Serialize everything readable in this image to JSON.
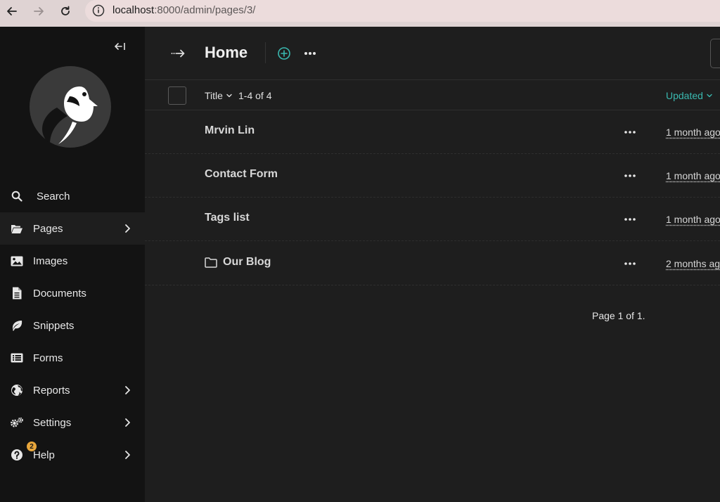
{
  "browser": {
    "url_host": "localhost",
    "url_path": ":8000/admin/pages/3/"
  },
  "sidebar": {
    "items": [
      {
        "label": "Search",
        "icon": "search-icon"
      },
      {
        "label": "Pages",
        "icon": "folder-open-icon"
      },
      {
        "label": "Images",
        "icon": "image-icon"
      },
      {
        "label": "Documents",
        "icon": "document-icon"
      },
      {
        "label": "Snippets",
        "icon": "leaf-icon"
      },
      {
        "label": "Forms",
        "icon": "list-icon"
      },
      {
        "label": "Reports",
        "icon": "globe-icon"
      },
      {
        "label": "Settings",
        "icon": "cogs-icon"
      },
      {
        "label": "Help",
        "icon": "help-icon"
      }
    ],
    "help_badge": "2"
  },
  "header": {
    "title": "Home"
  },
  "table": {
    "col_title": "Title",
    "count": "1-4 of 4",
    "col_updated": "Updated",
    "rows": [
      {
        "title": "Mrvin Lin",
        "updated": "1 month ago"
      },
      {
        "title": "Contact Form",
        "updated": "1 month ago"
      },
      {
        "title": "Tags list",
        "updated": "1 month ago"
      },
      {
        "title": "Our Blog",
        "updated": "2 months ago"
      }
    ]
  },
  "pagination": {
    "text": "Page 1 of 1."
  },
  "colors": {
    "accent": "#3ab9b0",
    "sidebar_bg": "#131313",
    "main_bg": "#1e1e1e",
    "badge": "#e8a63b"
  }
}
